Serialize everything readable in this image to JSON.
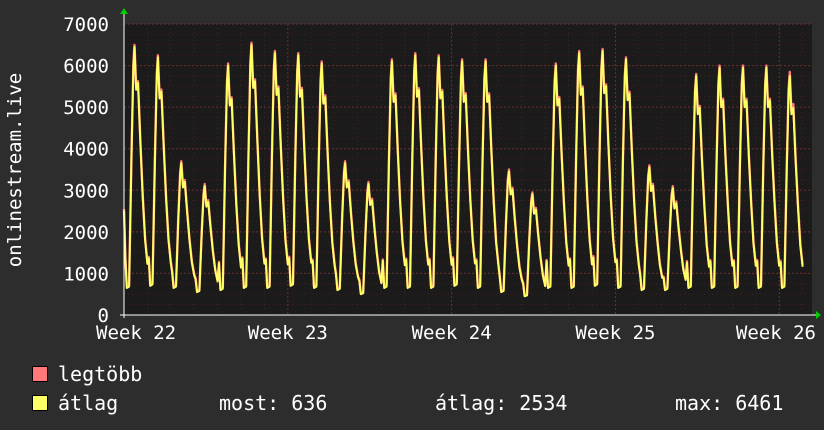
{
  "chart_data": {
    "type": "line",
    "ylabel": "onlinestream.live",
    "ylim": [
      0,
      7000
    ],
    "yticks": [
      0,
      1000,
      2000,
      3000,
      4000,
      5000,
      6000,
      7000
    ],
    "xticks": [
      "Week 22",
      "Week 23",
      "Week 24",
      "Week 25",
      "Week 26"
    ],
    "x_range_days": [
      0,
      29.4
    ],
    "grid": true,
    "colors": {
      "background": "#2d2d2d",
      "plot_bg": "#1b1b1b",
      "grid": "#7a3030",
      "max_line": "#ff7777",
      "avg_line": "#ffff66"
    },
    "daily_avg_peaks": [
      6450,
      6200,
      3650,
      3100,
      6000,
      6500,
      6300,
      6250,
      6050,
      3650,
      3150,
      6100,
      6250,
      6200,
      6100,
      6100,
      3450,
      2900,
      6000,
      6300,
      6350,
      6150,
      3550,
      3050,
      5750,
      5950,
      5950,
      5950,
      5750
    ],
    "daily_max_peaks": [
      6500,
      6250,
      3700,
      3150,
      6050,
      6550,
      6350,
      6300,
      6100,
      3700,
      3200,
      6150,
      6300,
      6250,
      6150,
      6150,
      3500,
      2950,
      6050,
      6350,
      6400,
      6200,
      3600,
      3100,
      5800,
      6000,
      6000,
      6000,
      5850
    ],
    "daily_avg_troughs": [
      650,
      700,
      650,
      550,
      600,
      650,
      650,
      700,
      650,
      600,
      500,
      650,
      650,
      650,
      700,
      650,
      550,
      450,
      650,
      650,
      700,
      650,
      600,
      600,
      650,
      650,
      650,
      650,
      650
    ],
    "series": [
      {
        "name": "legtöbb"
      },
      {
        "name": "átlag"
      }
    ]
  },
  "legend": {
    "max_label": "legtöbb",
    "avg_label": "átlag",
    "now": "most: 636",
    "average": "átlag: 2534",
    "max": "max: 6461"
  }
}
